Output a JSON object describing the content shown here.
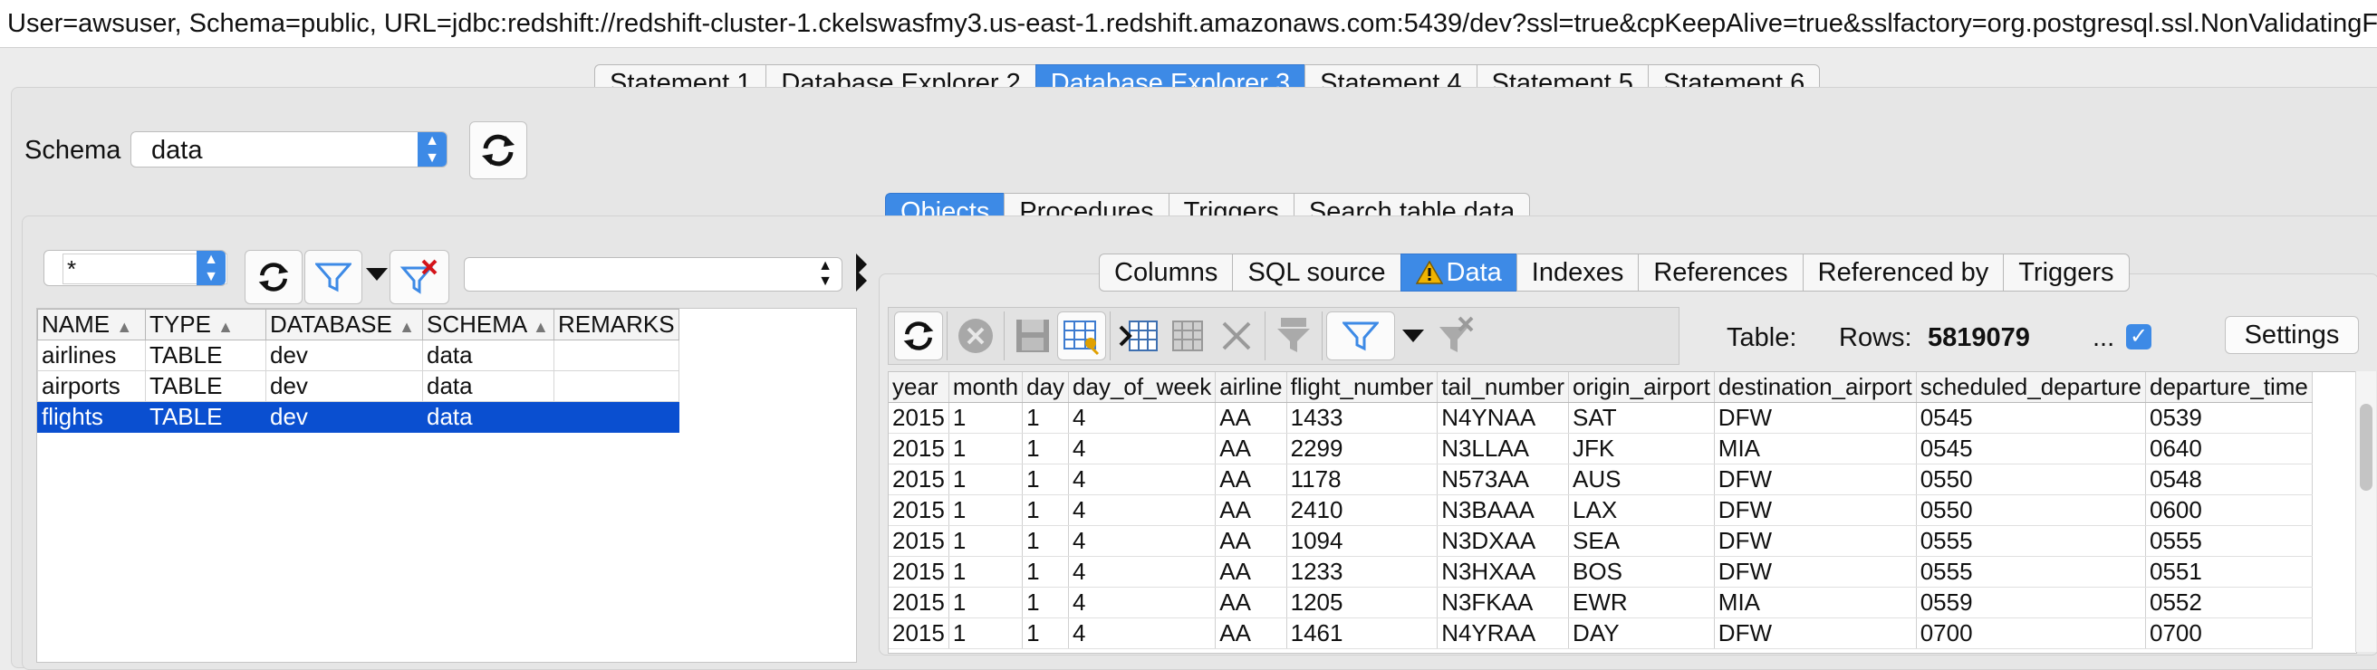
{
  "connection": {
    "text": "User=awsuser, Schema=public, URL=jdbc:redshift://redshift-cluster-1.ckelswasfmy3.us-east-1.redshift.amazonaws.com:5439/dev?ssl=true&cpKeepAlive=true&sslfactory=org.postgresql.ssl.NonValidatingF"
  },
  "main_tabs": [
    {
      "label": "Statement 1",
      "active": false
    },
    {
      "label": "Database Explorer 2",
      "active": false
    },
    {
      "label": "Database Explorer 3",
      "active": true
    },
    {
      "label": "Statement 4",
      "active": false
    },
    {
      "label": "Statement 5",
      "active": false
    },
    {
      "label": "Statement 6",
      "active": false
    }
  ],
  "schema": {
    "label": "Schema",
    "value": "data"
  },
  "object_tabs": [
    {
      "label": "Objects",
      "active": true
    },
    {
      "label": "Procedures",
      "active": false
    },
    {
      "label": "Triggers",
      "active": false
    },
    {
      "label": "Search table data",
      "active": false
    }
  ],
  "filter": {
    "name_filter": "*"
  },
  "object_table": {
    "columns": [
      "NAME",
      "TYPE",
      "DATABASE",
      "SCHEMA",
      "REMARKS"
    ],
    "rows": [
      {
        "name": "airlines",
        "type": "TABLE",
        "database": "dev",
        "schema": "data",
        "remarks": "",
        "selected": false
      },
      {
        "name": "airports",
        "type": "TABLE",
        "database": "dev",
        "schema": "data",
        "remarks": "",
        "selected": false
      },
      {
        "name": "flights",
        "type": "TABLE",
        "database": "dev",
        "schema": "data",
        "remarks": "",
        "selected": true
      }
    ]
  },
  "detail_tabs": [
    {
      "label": "Columns",
      "active": false
    },
    {
      "label": "SQL source",
      "active": false
    },
    {
      "label": "Data",
      "active": true,
      "icon": "warning-icon"
    },
    {
      "label": "Indexes",
      "active": false
    },
    {
      "label": "References",
      "active": false
    },
    {
      "label": "Referenced by",
      "active": false
    },
    {
      "label": "Triggers",
      "active": false
    }
  ],
  "data_toolbar": {
    "table_label": "Table:",
    "rows_label": "Rows:",
    "rows_value": "5819079",
    "ellipsis": "...",
    "settings_label": "Settings"
  },
  "data_grid": {
    "columns": [
      "year",
      "month",
      "day",
      "day_of_week",
      "airline",
      "flight_number",
      "tail_number",
      "origin_airport",
      "destination_airport",
      "scheduled_departure",
      "departure_time"
    ],
    "rows": [
      [
        "2015",
        "1",
        "1",
        "4",
        "AA",
        "1433",
        "N4YNAA",
        "SAT",
        "DFW",
        "0545",
        "0539"
      ],
      [
        "2015",
        "1",
        "1",
        "4",
        "AA",
        "2299",
        "N3LLAA",
        "JFK",
        "MIA",
        "0545",
        "0640"
      ],
      [
        "2015",
        "1",
        "1",
        "4",
        "AA",
        "1178",
        "N573AA",
        "AUS",
        "DFW",
        "0550",
        "0548"
      ],
      [
        "2015",
        "1",
        "1",
        "4",
        "AA",
        "2410",
        "N3BAAA",
        "LAX",
        "DFW",
        "0550",
        "0600"
      ],
      [
        "2015",
        "1",
        "1",
        "4",
        "AA",
        "1094",
        "N3DXAA",
        "SEA",
        "DFW",
        "0555",
        "0555"
      ],
      [
        "2015",
        "1",
        "1",
        "4",
        "AA",
        "1233",
        "N3HXAA",
        "BOS",
        "DFW",
        "0555",
        "0551"
      ],
      [
        "2015",
        "1",
        "1",
        "4",
        "AA",
        "1205",
        "N3FKAA",
        "EWR",
        "MIA",
        "0559",
        "0552"
      ],
      [
        "2015",
        "1",
        "1",
        "4",
        "AA",
        "1461",
        "N4YRAA",
        "DAY",
        "DFW",
        "0700",
        "0700"
      ]
    ]
  },
  "colors": {
    "accent": "#3d8ae6",
    "selection": "#0a4fd0",
    "warning": "#f0b400"
  }
}
